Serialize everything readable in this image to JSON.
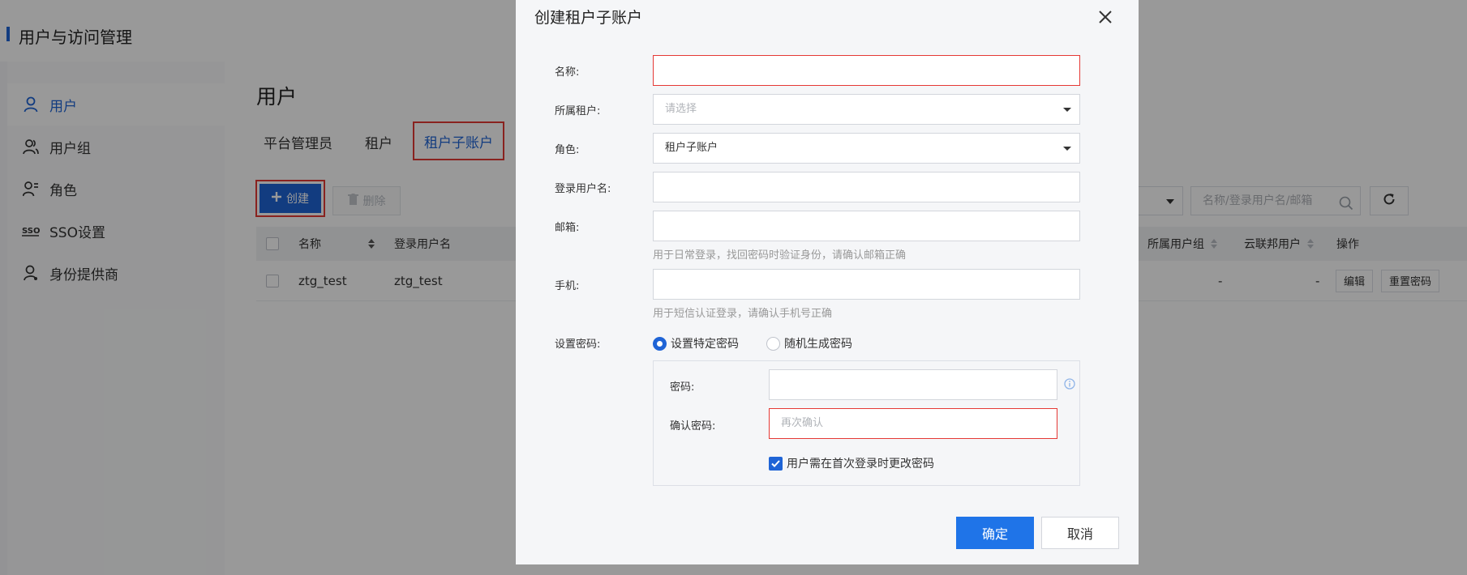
{
  "app": {
    "title": "用户与访问管理"
  },
  "sidebar": {
    "items": [
      {
        "label": "用户",
        "icon": "user-icon",
        "active": true
      },
      {
        "label": "用户组",
        "icon": "user-group-icon",
        "active": false
      },
      {
        "label": "角色",
        "icon": "role-icon",
        "active": false
      },
      {
        "label": "SSO设置",
        "icon": "sso-icon",
        "active": false
      },
      {
        "label": "身份提供商",
        "icon": "identity-provider-icon",
        "active": false
      }
    ]
  },
  "main": {
    "title": "用户",
    "tabs": [
      {
        "label": "平台管理员"
      },
      {
        "label": "租户"
      },
      {
        "label": "租户子账户",
        "active": true
      }
    ],
    "toolbar": {
      "create_label": "创建",
      "delete_label": "删除",
      "search_placeholder": "名称/登录用户名/邮箱"
    },
    "table": {
      "columns": {
        "name": "名称",
        "login": "登录用户名",
        "group": "所属用户组",
        "federated": "云联邦用户",
        "actions": "操作"
      },
      "rows": [
        {
          "name": "ztg_test",
          "login": "ztg_test",
          "group": "-",
          "federated": "-",
          "edit": "编辑",
          "reset": "重置密码"
        }
      ]
    }
  },
  "modal": {
    "title": "创建租户子账户",
    "fields": {
      "name_label": "名称:",
      "name_value": "",
      "tenant_label": "所属租户:",
      "tenant_placeholder": "请选择",
      "role_label": "角色:",
      "role_value": "租户子账户",
      "login_label": "登录用户名:",
      "login_value": "",
      "email_label": "邮箱:",
      "email_value": "",
      "email_hint": "用于日常登录，找回密码时验证身份，请确认邮箱正确",
      "phone_label": "手机:",
      "phone_value": "",
      "phone_hint": "用于短信认证登录，请确认手机号正确",
      "pwd_setting_label": "设置密码:",
      "pwd_option_specific": "设置特定密码",
      "pwd_option_random": "随机生成密码",
      "password_label": "密码:",
      "password_value": "",
      "confirm_label": "确认密码:",
      "confirm_placeholder": "再次确认",
      "force_change_label": "用户需在首次登录时更改密码"
    },
    "buttons": {
      "ok": "确定",
      "cancel": "取消"
    },
    "colors": {
      "primary": "#1f74e8",
      "error": "#e53935"
    }
  }
}
